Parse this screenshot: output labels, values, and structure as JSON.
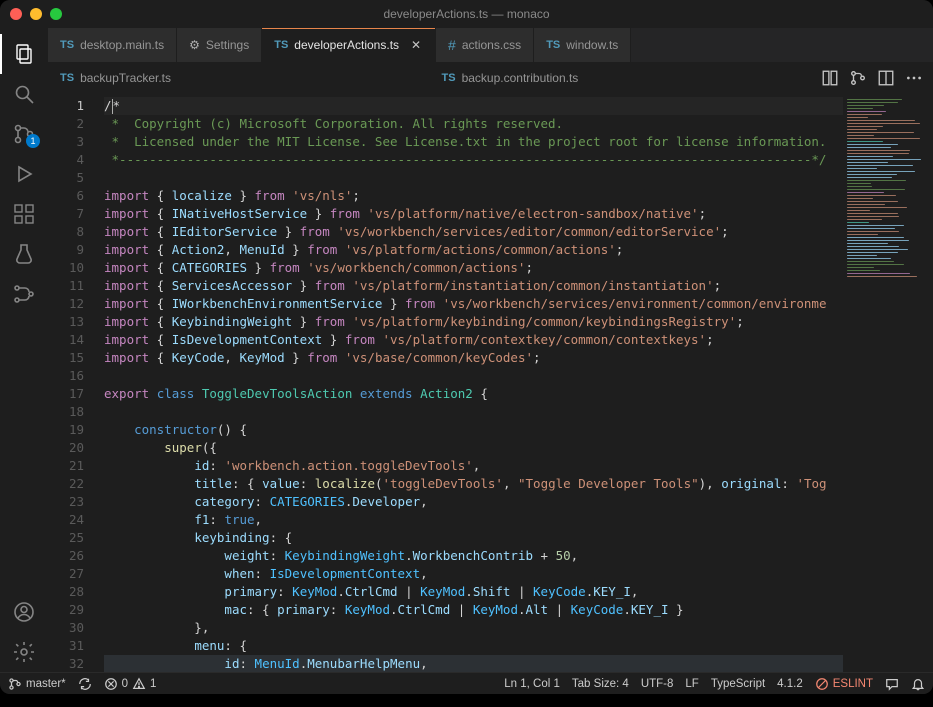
{
  "titlebar": {
    "title": "developerActions.ts — monaco"
  },
  "activity": {
    "badge_scm": "1",
    "icons": [
      "files",
      "search",
      "scm",
      "debug",
      "extensions",
      "testing",
      "references"
    ]
  },
  "tabs_row1": [
    {
      "icon": "ts",
      "label": "desktop.main.ts",
      "active": false,
      "closable": false
    },
    {
      "icon": "gear",
      "label": "Settings",
      "active": false,
      "closable": false
    },
    {
      "icon": "ts",
      "label": "developerActions.ts",
      "active": true,
      "closable": true
    },
    {
      "icon": "css",
      "label": "actions.css",
      "active": false,
      "closable": false
    },
    {
      "icon": "ts",
      "label": "window.ts",
      "active": false,
      "closable": false
    }
  ],
  "tabs_row2": [
    {
      "icon": "ts",
      "label": "backupTracker.ts"
    },
    {
      "icon": "ts",
      "label": "backup.contribution.ts"
    }
  ],
  "gutter": {
    "start": 1,
    "end": 32,
    "current": 1
  },
  "code_lines": [
    [
      [
        "plain",
        "/"
      ],
      [
        "cursor",
        ""
      ],
      [
        "plain",
        "*"
      ]
    ],
    [
      [
        "cmt",
        " *  Copyright (c) Microsoft Corporation. All rights reserved."
      ]
    ],
    [
      [
        "cmt",
        " *  Licensed under the MIT License. See License.txt in the project root for license information."
      ]
    ],
    [
      [
        "cmt",
        " *--------------------------------------------------------------------------------------------*/"
      ]
    ],
    [],
    [
      [
        "kw",
        "import"
      ],
      [
        "plain",
        " { "
      ],
      [
        "id",
        "localize"
      ],
      [
        "plain",
        " } "
      ],
      [
        "kw",
        "from"
      ],
      [
        "plain",
        " "
      ],
      [
        "str",
        "'vs/nls'"
      ],
      [
        "plain",
        ";"
      ]
    ],
    [
      [
        "kw",
        "import"
      ],
      [
        "plain",
        " { "
      ],
      [
        "id",
        "INativeHostService"
      ],
      [
        "plain",
        " } "
      ],
      [
        "kw",
        "from"
      ],
      [
        "plain",
        " "
      ],
      [
        "str",
        "'vs/platform/native/electron-sandbox/native'"
      ],
      [
        "plain",
        ";"
      ]
    ],
    [
      [
        "kw",
        "import"
      ],
      [
        "plain",
        " { "
      ],
      [
        "id",
        "IEditorService"
      ],
      [
        "plain",
        " } "
      ],
      [
        "kw",
        "from"
      ],
      [
        "plain",
        " "
      ],
      [
        "str",
        "'vs/workbench/services/editor/common/editorService'"
      ],
      [
        "plain",
        ";"
      ]
    ],
    [
      [
        "kw",
        "import"
      ],
      [
        "plain",
        " { "
      ],
      [
        "id",
        "Action2"
      ],
      [
        "plain",
        ", "
      ],
      [
        "id",
        "MenuId"
      ],
      [
        "plain",
        " } "
      ],
      [
        "kw",
        "from"
      ],
      [
        "plain",
        " "
      ],
      [
        "str",
        "'vs/platform/actions/common/actions'"
      ],
      [
        "plain",
        ";"
      ]
    ],
    [
      [
        "kw",
        "import"
      ],
      [
        "plain",
        " { "
      ],
      [
        "id",
        "CATEGORIES"
      ],
      [
        "plain",
        " } "
      ],
      [
        "kw",
        "from"
      ],
      [
        "plain",
        " "
      ],
      [
        "str",
        "'vs/workbench/common/actions'"
      ],
      [
        "plain",
        ";"
      ]
    ],
    [
      [
        "kw",
        "import"
      ],
      [
        "plain",
        " { "
      ],
      [
        "id",
        "ServicesAccessor"
      ],
      [
        "plain",
        " } "
      ],
      [
        "kw",
        "from"
      ],
      [
        "plain",
        " "
      ],
      [
        "str",
        "'vs/platform/instantiation/common/instantiation'"
      ],
      [
        "plain",
        ";"
      ]
    ],
    [
      [
        "kw",
        "import"
      ],
      [
        "plain",
        " { "
      ],
      [
        "id",
        "IWorkbenchEnvironmentService"
      ],
      [
        "plain",
        " } "
      ],
      [
        "kw",
        "from"
      ],
      [
        "plain",
        " "
      ],
      [
        "str",
        "'vs/workbench/services/environment/common/environme"
      ]
    ],
    [
      [
        "kw",
        "import"
      ],
      [
        "plain",
        " { "
      ],
      [
        "id",
        "KeybindingWeight"
      ],
      [
        "plain",
        " } "
      ],
      [
        "kw",
        "from"
      ],
      [
        "plain",
        " "
      ],
      [
        "str",
        "'vs/platform/keybinding/common/keybindingsRegistry'"
      ],
      [
        "plain",
        ";"
      ]
    ],
    [
      [
        "kw",
        "import"
      ],
      [
        "plain",
        " { "
      ],
      [
        "id",
        "IsDevelopmentContext"
      ],
      [
        "plain",
        " } "
      ],
      [
        "kw",
        "from"
      ],
      [
        "plain",
        " "
      ],
      [
        "str",
        "'vs/platform/contextkey/common/contextkeys'"
      ],
      [
        "plain",
        ";"
      ]
    ],
    [
      [
        "kw",
        "import"
      ],
      [
        "plain",
        " { "
      ],
      [
        "id",
        "KeyCode"
      ],
      [
        "plain",
        ", "
      ],
      [
        "id",
        "KeyMod"
      ],
      [
        "plain",
        " } "
      ],
      [
        "kw",
        "from"
      ],
      [
        "plain",
        " "
      ],
      [
        "str",
        "'vs/base/common/keyCodes'"
      ],
      [
        "plain",
        ";"
      ]
    ],
    [],
    [
      [
        "kw",
        "export"
      ],
      [
        "plain",
        " "
      ],
      [
        "type",
        "class"
      ],
      [
        "plain",
        " "
      ],
      [
        "cls",
        "ToggleDevToolsAction"
      ],
      [
        "plain",
        " "
      ],
      [
        "type",
        "extends"
      ],
      [
        "plain",
        " "
      ],
      [
        "cls",
        "Action2"
      ],
      [
        "plain",
        " {"
      ]
    ],
    [],
    [
      [
        "plain",
        "    "
      ],
      [
        "type",
        "constructor"
      ],
      [
        "plain",
        "() {"
      ]
    ],
    [
      [
        "plain",
        "        "
      ],
      [
        "fn",
        "super"
      ],
      [
        "plain",
        "({"
      ]
    ],
    [
      [
        "plain",
        "            "
      ],
      [
        "prop",
        "id"
      ],
      [
        "plain",
        ": "
      ],
      [
        "str",
        "'workbench.action.toggleDevTools'"
      ],
      [
        "plain",
        ","
      ]
    ],
    [
      [
        "plain",
        "            "
      ],
      [
        "prop",
        "title"
      ],
      [
        "plain",
        ": { "
      ],
      [
        "prop",
        "value"
      ],
      [
        "plain",
        ": "
      ],
      [
        "fn",
        "localize"
      ],
      [
        "plain",
        "("
      ],
      [
        "str",
        "'toggleDevTools'"
      ],
      [
        "plain",
        ", "
      ],
      [
        "str",
        "\"Toggle Developer Tools\""
      ],
      [
        "plain",
        "), "
      ],
      [
        "prop",
        "original"
      ],
      [
        "plain",
        ": "
      ],
      [
        "str",
        "'Tog"
      ]
    ],
    [
      [
        "plain",
        "            "
      ],
      [
        "prop",
        "category"
      ],
      [
        "plain",
        ": "
      ],
      [
        "const",
        "CATEGORIES"
      ],
      [
        "plain",
        "."
      ],
      [
        "prop",
        "Developer"
      ],
      [
        "plain",
        ","
      ]
    ],
    [
      [
        "plain",
        "            "
      ],
      [
        "prop",
        "f1"
      ],
      [
        "plain",
        ": "
      ],
      [
        "type",
        "true"
      ],
      [
        "plain",
        ","
      ]
    ],
    [
      [
        "plain",
        "            "
      ],
      [
        "prop",
        "keybinding"
      ],
      [
        "plain",
        ": {"
      ]
    ],
    [
      [
        "plain",
        "                "
      ],
      [
        "prop",
        "weight"
      ],
      [
        "plain",
        ": "
      ],
      [
        "const",
        "KeybindingWeight"
      ],
      [
        "plain",
        "."
      ],
      [
        "prop",
        "WorkbenchContrib"
      ],
      [
        "plain",
        " + "
      ],
      [
        "num",
        "50"
      ],
      [
        "plain",
        ","
      ]
    ],
    [
      [
        "plain",
        "                "
      ],
      [
        "prop",
        "when"
      ],
      [
        "plain",
        ": "
      ],
      [
        "const",
        "IsDevelopmentContext"
      ],
      [
        "plain",
        ","
      ]
    ],
    [
      [
        "plain",
        "                "
      ],
      [
        "prop",
        "primary"
      ],
      [
        "plain",
        ": "
      ],
      [
        "const",
        "KeyMod"
      ],
      [
        "plain",
        "."
      ],
      [
        "prop",
        "CtrlCmd"
      ],
      [
        "plain",
        " | "
      ],
      [
        "const",
        "KeyMod"
      ],
      [
        "plain",
        "."
      ],
      [
        "prop",
        "Shift"
      ],
      [
        "plain",
        " | "
      ],
      [
        "const",
        "KeyCode"
      ],
      [
        "plain",
        "."
      ],
      [
        "prop",
        "KEY_I"
      ],
      [
        "plain",
        ","
      ]
    ],
    [
      [
        "plain",
        "                "
      ],
      [
        "prop",
        "mac"
      ],
      [
        "plain",
        ": { "
      ],
      [
        "prop",
        "primary"
      ],
      [
        "plain",
        ": "
      ],
      [
        "const",
        "KeyMod"
      ],
      [
        "plain",
        "."
      ],
      [
        "prop",
        "CtrlCmd"
      ],
      [
        "plain",
        " | "
      ],
      [
        "const",
        "KeyMod"
      ],
      [
        "plain",
        "."
      ],
      [
        "prop",
        "Alt"
      ],
      [
        "plain",
        " | "
      ],
      [
        "const",
        "KeyCode"
      ],
      [
        "plain",
        "."
      ],
      [
        "prop",
        "KEY_I"
      ],
      [
        "plain",
        " }"
      ]
    ],
    [
      [
        "plain",
        "            },"
      ]
    ],
    [
      [
        "plain",
        "            "
      ],
      [
        "prop",
        "menu"
      ],
      [
        "plain",
        ": {"
      ]
    ],
    [
      [
        "plain",
        "                "
      ],
      [
        "prop",
        "id"
      ],
      [
        "plain",
        ": "
      ],
      [
        "const",
        "MenuId"
      ],
      [
        "plain",
        "."
      ],
      [
        "prop",
        "MenubarHelpMenu"
      ],
      [
        "plain",
        ","
      ]
    ]
  ],
  "status": {
    "branch": "master*",
    "errors": "0",
    "warnings": "1",
    "cursor": "Ln 1, Col 1",
    "tabsize": "Tab Size: 4",
    "encoding": "UTF-8",
    "eol": "LF",
    "language": "TypeScript",
    "ts_version": "4.1.2",
    "eslint": "ESLINT"
  }
}
